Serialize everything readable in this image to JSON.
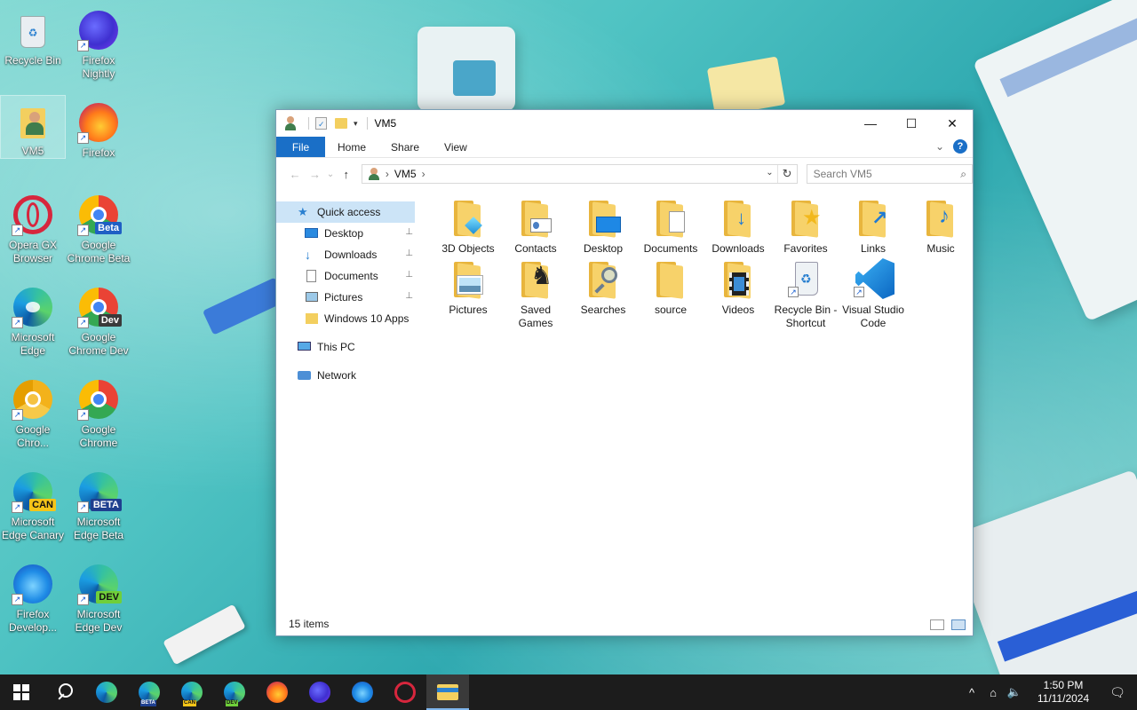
{
  "colors": {
    "accent": "#1a6fc7",
    "folder_back": "#e8b53d",
    "folder_front": "#f7d26a",
    "selection": "#cce4f7",
    "taskbar": "#1c1c1c"
  },
  "desktop": {
    "icons": [
      {
        "label": "Recycle Bin",
        "icon": "recycle-bin-icon"
      },
      {
        "label": "Firefox Nightly",
        "icon": "firefox-nightly-icon"
      },
      {
        "label": "VM5",
        "icon": "user-folder-icon"
      },
      {
        "label": "Firefox",
        "icon": "firefox-icon"
      },
      {
        "label": "Opera GX Browser",
        "icon": "opera-gx-icon"
      },
      {
        "label": "Google Chrome Beta",
        "icon": "chrome-beta-icon",
        "tag": "Beta"
      },
      {
        "label": "Microsoft Edge",
        "icon": "edge-icon"
      },
      {
        "label": "Google Chrome Dev",
        "icon": "chrome-dev-icon",
        "tag": "Dev"
      },
      {
        "label": "Google Chro...",
        "icon": "chrome-canary-icon"
      },
      {
        "label": "Google Chrome",
        "icon": "chrome-icon"
      },
      {
        "label": "Microsoft Edge Canary",
        "icon": "edge-canary-icon",
        "tag": "CAN"
      },
      {
        "label": "Microsoft Edge Beta",
        "icon": "edge-beta-icon",
        "tag": "BETA"
      },
      {
        "label": "Firefox Develop...",
        "icon": "firefox-developer-icon"
      },
      {
        "label": "Microsoft Edge Dev",
        "icon": "edge-dev-icon",
        "tag": "DEV"
      }
    ]
  },
  "window": {
    "title": "VM5",
    "controls": {
      "minimize": "—",
      "maximize": "☐",
      "close": "✕"
    },
    "ribbon": {
      "tabs": [
        "File",
        "Home",
        "Share",
        "View"
      ],
      "expand": "⌄",
      "help": "?"
    },
    "nav": {
      "back": "←",
      "forward": "→",
      "recent": "⌄",
      "up": "↑",
      "address_sep": "›",
      "address": [
        "VM5"
      ],
      "dropdown": "⌄",
      "refresh": "↻",
      "search_placeholder": "Search VM5",
      "search_icon": "⌕"
    },
    "navpane": [
      {
        "label": "Quick access",
        "icon": "star-icon"
      },
      {
        "label": "Desktop",
        "icon": "desktop-icon",
        "pinned": true
      },
      {
        "label": "Downloads",
        "icon": "download-icon",
        "pinned": true
      },
      {
        "label": "Documents",
        "icon": "document-icon",
        "pinned": true
      },
      {
        "label": "Pictures",
        "icon": "picture-icon",
        "pinned": true
      },
      {
        "label": "Windows 10 Apps",
        "icon": "folder-icon"
      },
      {
        "label": "This PC",
        "icon": "computer-icon"
      },
      {
        "label": "Network",
        "icon": "network-icon"
      }
    ],
    "pin_glyph": "📌",
    "files": [
      {
        "label": "3D Objects",
        "icon": "3d-objects-folder-icon"
      },
      {
        "label": "Contacts",
        "icon": "contacts-folder-icon"
      },
      {
        "label": "Desktop",
        "icon": "desktop-folder-icon"
      },
      {
        "label": "Documents",
        "icon": "documents-folder-icon"
      },
      {
        "label": "Downloads",
        "icon": "downloads-folder-icon"
      },
      {
        "label": "Favorites",
        "icon": "favorites-folder-icon"
      },
      {
        "label": "Links",
        "icon": "links-folder-icon"
      },
      {
        "label": "Music",
        "icon": "music-folder-icon"
      },
      {
        "label": "Pictures",
        "icon": "pictures-folder-icon"
      },
      {
        "label": "Saved Games",
        "icon": "saved-games-folder-icon"
      },
      {
        "label": "Searches",
        "icon": "searches-folder-icon"
      },
      {
        "label": "source",
        "icon": "folder-icon"
      },
      {
        "label": "Videos",
        "icon": "videos-folder-icon"
      },
      {
        "label": "Recycle Bin - Shortcut",
        "icon": "recycle-bin-shortcut-icon"
      },
      {
        "label": "Visual Studio Code",
        "icon": "vscode-icon"
      }
    ],
    "status": "15 items"
  },
  "taskbar": {
    "items": [
      {
        "icon": "start-icon"
      },
      {
        "icon": "search-icon"
      },
      {
        "icon": "edge-icon"
      },
      {
        "icon": "edge-beta-icon",
        "mini": "BETA"
      },
      {
        "icon": "edge-canary-icon",
        "mini": "CAN"
      },
      {
        "icon": "edge-dev-icon",
        "mini": "DEV"
      },
      {
        "icon": "firefox-icon"
      },
      {
        "icon": "firefox-nightly-icon"
      },
      {
        "icon": "firefox-developer-icon"
      },
      {
        "icon": "opera-gx-icon"
      },
      {
        "icon": "file-explorer-icon",
        "active": true
      }
    ],
    "tray": {
      "chevron": "^",
      "network": "⌂",
      "volume": "🔈",
      "time": "1:50 PM",
      "date": "11/11/2024",
      "notification": "🗨"
    }
  }
}
